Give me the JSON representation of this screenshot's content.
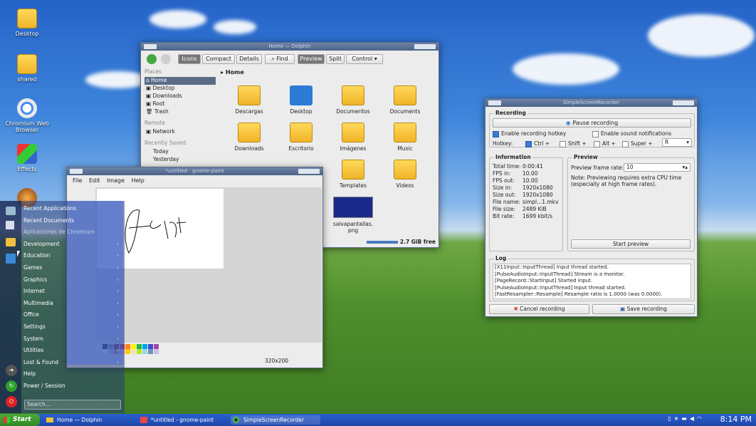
{
  "desktop": {
    "icons": [
      "Desktop",
      "shared",
      "Chromium Web Browser",
      "Effects"
    ]
  },
  "dolphin": {
    "title": "Home — Dolphin",
    "toolbar": {
      "icons": "Icons",
      "compact": "Compact",
      "details": "Details",
      "find": "Find",
      "preview": "Preview",
      "split": "Split",
      "control": "Control"
    },
    "places": {
      "header": "Places",
      "items": [
        "Home",
        "Desktop",
        "Downloads",
        "Root",
        "Trash"
      ],
      "remote_header": "Remote",
      "remote_items": [
        "Network"
      ],
      "recent_header": "Recently Saved",
      "recent_items": [
        "Today",
        "Yesterday"
      ]
    },
    "breadcrumb": "Home",
    "files": [
      "Descargas",
      "Desktop",
      "Documentos",
      "Documents",
      "Downloads",
      "Escritorio",
      "Imágenes",
      "Music",
      "Templates",
      "Videos",
      "salvapantallas.\npng"
    ],
    "status": "2.7 GiB free"
  },
  "paint": {
    "title": "*untitled - gnome-paint",
    "menu": [
      "File",
      "Edit",
      "Image",
      "Help"
    ],
    "size": "320x200",
    "palette": [
      "#000000",
      "#7f7f7f",
      "#880015",
      "#ed1c24",
      "#ff7f27",
      "#fff200",
      "#22b14c",
      "#00a2e8",
      "#3f48cc",
      "#a349a4",
      "#ffffff",
      "#c3c3c3",
      "#b97a57",
      "#ffaec9",
      "#ffc90e",
      "#efe4b0",
      "#b5e61d",
      "#99d9ea",
      "#7092be",
      "#c8bfe7"
    ]
  },
  "ssr": {
    "title": "SimpleScreenRecorder",
    "recording_title": "Recording",
    "pause": "Pause recording",
    "enable_hotkey": "Enable recording hotkey",
    "enable_sound": "Enable sound notifications",
    "hotkey_label": "Hotkey:",
    "ctrl": "Ctrl +",
    "shift": "Shift +",
    "alt": "Alt +",
    "super": "Super +",
    "key": "R",
    "info_title": "Information",
    "info": [
      [
        "Total time:",
        "0:00:41"
      ],
      [
        "FPS in:",
        "10.00"
      ],
      [
        "FPS out:",
        "10.00"
      ],
      [
        "Size in:",
        "1920x1080"
      ],
      [
        "Size out:",
        "1920x1080"
      ],
      [
        "File name:",
        "simpl...1.mkv"
      ],
      [
        "File size:",
        "2489 KiB"
      ],
      [
        "Bit rate:",
        "1699 kbit/s"
      ]
    ],
    "preview_title": "Preview",
    "frame_rate_label": "Preview frame rate:",
    "frame_rate": "10",
    "note": "Note: Previewing requires extra CPU time (especially at high frame rates).",
    "start_preview": "Start preview",
    "log_title": "Log",
    "log": [
      "[X11Input::InputThread] Input thread started.",
      "[PulseAudioInput::InputThread] Stream is a monitor.",
      "[PageRecord::StartInput] Started input.",
      "[PulseAudioInput::InputThread] Input thread started.",
      "[FastResampler::Resample] Resample ratio is 1.0000 (was 0.0000)."
    ],
    "cancel": "Cancel recording",
    "save": "Save recording"
  },
  "start_menu": {
    "items": [
      "Recent Applications",
      "Recent Documents",
      "Aplicaciones de Chromium",
      "Development",
      "Education",
      "Games",
      "Graphics",
      "Internet",
      "Multimedia",
      "Office",
      "Settings",
      "System",
      "Utilities",
      "Lost & Found",
      "Help",
      "Power / Session"
    ],
    "search_placeholder": "Search..."
  },
  "taskbar": {
    "start": "Start",
    "tasks": [
      "Home — Dolphin",
      "*untitled - gnome-paint",
      "SimpleScreenRecorder"
    ],
    "clock": "8:14 PM"
  }
}
